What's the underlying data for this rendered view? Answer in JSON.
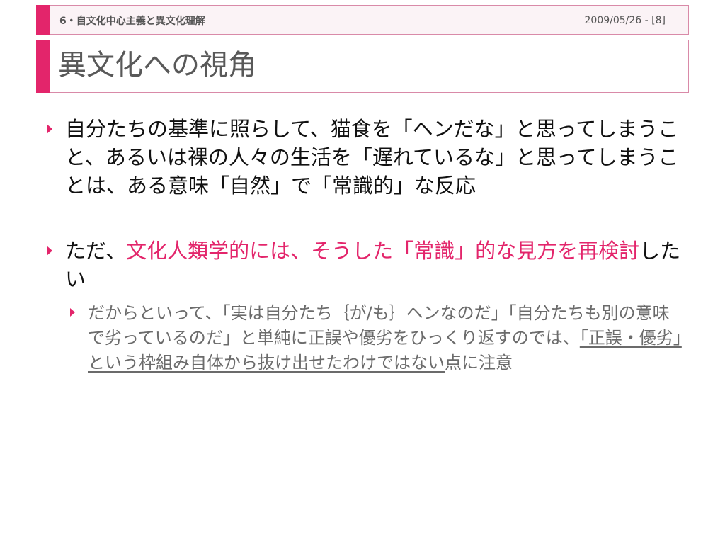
{
  "header": {
    "section": "6・自文化中心主義と異文化理解",
    "date_page": "2009/05/26 - [8]"
  },
  "title": "異文化への視角",
  "bullets": [
    {
      "text": "自分たちの基準に照らして、猫食を「ヘンだな」と思ってしまうこと、あるいは裸の人々の生活を「遅れているな」と思ってしまうことは、ある意味「自然」で「常識的」な反応"
    },
    {
      "prefix": "ただ、",
      "highlight": "文化人類学的には、そうした「常識」的な見方を再検討",
      "suffix": "したい"
    }
  ],
  "sub_bullet": {
    "lead": "だからといって、「実は自分たち｛が/も｝ヘンなのだ」「自分たちも別の意味で劣っているのだ」と単純に正誤や優劣をひっくり返すのでは、",
    "underlined": "「正誤・優劣」という枠組み自体から抜け出せたわけではない",
    "tail": "点に注意"
  },
  "colors": {
    "accent": "#e3256b",
    "border": "#d98aa8",
    "sub_text": "#6b6b6b"
  }
}
